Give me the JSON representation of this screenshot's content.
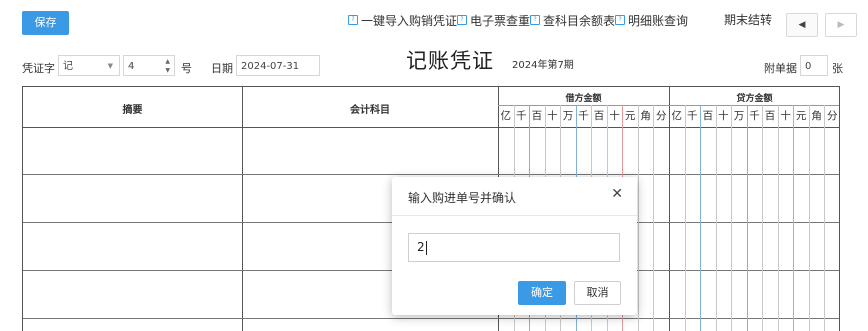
{
  "toolbar": {
    "save_label": "保存",
    "links": [
      "一键导入购销凭证",
      "电子票查重",
      "查科目余额表",
      "明细账查询"
    ],
    "period_end_label": "期末结转",
    "prev_icon": "◀",
    "next_icon": "▶"
  },
  "voucher": {
    "word_label": "凭证字",
    "word_value": "记",
    "number_value": "4",
    "number_suffix": "号",
    "date_label": "日期",
    "date_value": "2024-07-31",
    "title": "记账凭证",
    "period": "2024年第7期",
    "attach_label": "附单据",
    "attach_value": "0",
    "attach_unit": "张"
  },
  "table": {
    "col_summary": "摘要",
    "col_account": "会计科目",
    "col_debit": "借方金额",
    "col_credit": "贷方金额",
    "digits": [
      "亿",
      "千",
      "百",
      "十",
      "万",
      "千",
      "百",
      "十",
      "元",
      "角",
      "分"
    ]
  },
  "dialog": {
    "title": "输入购进单号并确认",
    "close_icon": "✕",
    "input_value": "2",
    "ok_label": "确定",
    "cancel_label": "取消"
  }
}
